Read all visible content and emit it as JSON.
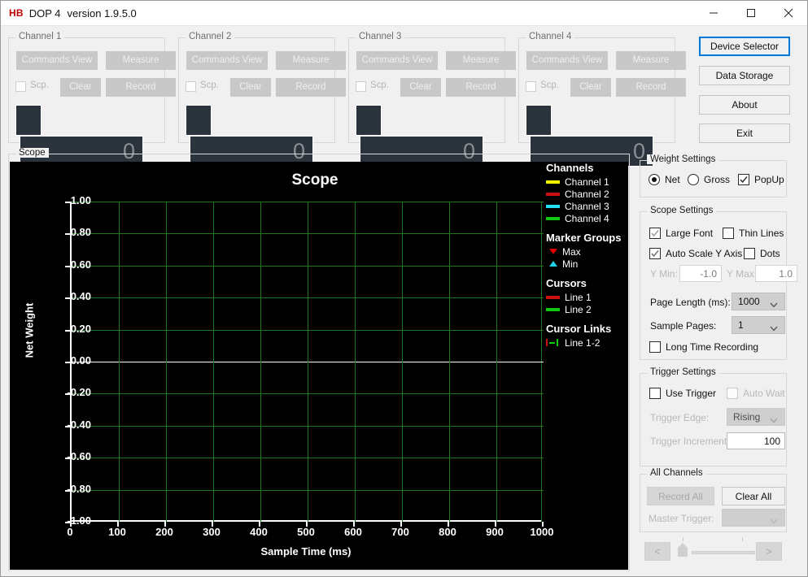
{
  "window": {
    "logo": "HB",
    "app_name": "DOP 4",
    "version": "version 1.9.5.0",
    "minimize_icon": "minimize-icon",
    "maximize_icon": "maximize-icon",
    "close_icon": "close-icon"
  },
  "channels": [
    {
      "title": "Channel 1",
      "commands_view": "Commands View",
      "measure": "Measure",
      "scp": "Scp.",
      "clear": "Clear",
      "record": "Record",
      "value": "0"
    },
    {
      "title": "Channel 2",
      "commands_view": "Commands View",
      "measure": "Measure",
      "scp": "Scp.",
      "clear": "Clear",
      "record": "Record",
      "value": "0"
    },
    {
      "title": "Channel 3",
      "commands_view": "Commands View",
      "measure": "Measure",
      "scp": "Scp.",
      "clear": "Clear",
      "record": "Record",
      "value": "0"
    },
    {
      "title": "Channel 4",
      "commands_view": "Commands View",
      "measure": "Measure",
      "scp": "Scp.",
      "clear": "Clear",
      "record": "Record",
      "value": "0"
    }
  ],
  "top_buttons": {
    "device_selector": "Device Selector",
    "data_storage": "Data Storage",
    "about": "About",
    "exit": "Exit"
  },
  "scope_group": {
    "label": "Scope"
  },
  "weight_settings": {
    "label": "Weight Settings",
    "net": "Net",
    "gross": "Gross",
    "popup": "PopUp",
    "net_selected": true,
    "gross_selected": false,
    "popup_checked": true
  },
  "scope_settings": {
    "label": "Scope Settings",
    "large_font": "Large Font",
    "large_font_checked": true,
    "thin_lines": "Thin Lines",
    "thin_lines_checked": false,
    "auto_scale": "Auto Scale Y Axis",
    "auto_scale_checked": true,
    "dots": "Dots",
    "dots_checked": false,
    "y_min_label": "Y Min:",
    "y_min_value": "-1.0",
    "y_max_label": "Y Max:",
    "y_max_value": "1.0",
    "page_length_label": "Page Length (ms):",
    "page_length_value": "1000",
    "sample_pages_label": "Sample Pages:",
    "sample_pages_value": "1",
    "long_time_recording": "Long Time Recording",
    "long_time_recording_checked": false
  },
  "trigger_settings": {
    "label": "Trigger Settings",
    "use_trigger": "Use Trigger",
    "use_trigger_checked": false,
    "auto_wait": "Auto Wait",
    "auto_wait_checked": false,
    "trigger_edge_label": "Trigger Edge:",
    "trigger_edge_value": "Rising",
    "trigger_increments_label": "Trigger Increments:",
    "trigger_increments_value": "100"
  },
  "all_channels": {
    "label": "All Channels",
    "record_all": "Record All",
    "clear_all": "Clear All",
    "master_trigger_label": "Master Trigger:",
    "master_trigger_value": ""
  },
  "pager": {
    "prev": "<",
    "next": ">"
  },
  "legend": {
    "channels_head": "Channels",
    "channels": [
      {
        "label": "Channel 1",
        "color": "#f2f200"
      },
      {
        "label": "Channel 2",
        "color": "#cc1111"
      },
      {
        "label": "Channel 3",
        "color": "#22e0f0"
      },
      {
        "label": "Channel 4",
        "color": "#11c911"
      }
    ],
    "marker_head": "Marker Groups",
    "markers": [
      {
        "label": "Max",
        "color": "#e00000",
        "glyph": "triangle-down-icon"
      },
      {
        "label": "Min",
        "color": "#22d3e8",
        "glyph": "triangle-up-icon"
      }
    ],
    "cursors_head": "Cursors",
    "cursors": [
      {
        "label": "Line 1",
        "color": "#cc1111"
      },
      {
        "label": "Line 2",
        "color": "#11c911"
      }
    ],
    "links_head": "Cursor Links",
    "links": [
      {
        "label": "Line 1-2",
        "color_left": "#cc1111",
        "color_right": "#11c911"
      }
    ]
  },
  "chart_data": {
    "type": "line",
    "title": "Scope",
    "xlabel": "Sample Time (ms)",
    "ylabel": "Net Weight",
    "xlim": [
      0,
      1000
    ],
    "ylim": [
      -1.0,
      1.0
    ],
    "xticks": [
      "0",
      "100",
      "200",
      "300",
      "400",
      "500",
      "600",
      "700",
      "800",
      "900",
      "1000"
    ],
    "yticks": [
      "1.00",
      "0.80",
      "0.60",
      "0.40",
      "0.20",
      "0.00",
      "-0.20",
      "-0.40",
      "-0.60",
      "-0.80",
      "-1.00"
    ],
    "grid": true,
    "grid_color": "#1f7a1f",
    "zero_line_color": "#ffffff",
    "background": "#000000",
    "legend_position": "right",
    "series": [
      {
        "name": "Channel 1",
        "color": "#f2f200",
        "x": [],
        "values": []
      },
      {
        "name": "Channel 2",
        "color": "#cc1111",
        "x": [],
        "values": []
      },
      {
        "name": "Channel 3",
        "color": "#22e0f0",
        "x": [],
        "values": []
      },
      {
        "name": "Channel 4",
        "color": "#11c911",
        "x": [],
        "values": []
      }
    ]
  }
}
